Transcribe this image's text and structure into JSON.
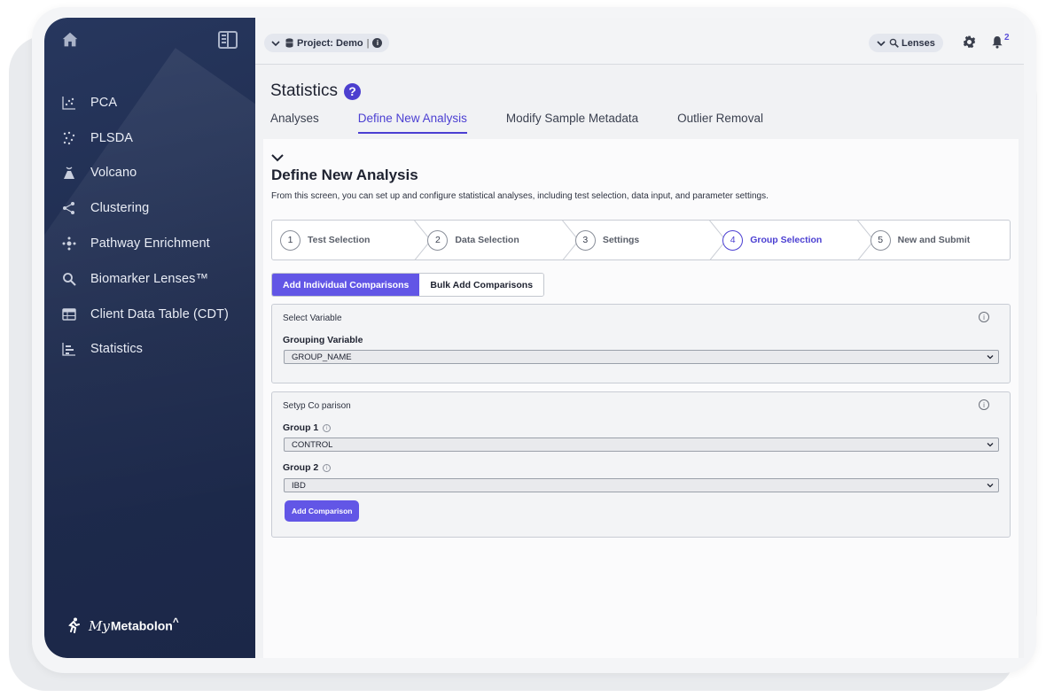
{
  "sidebar": {
    "items": [
      {
        "label": "PCA",
        "icon": "scatter-icon"
      },
      {
        "label": "PLSDA",
        "icon": "scatter-dots-icon"
      },
      {
        "label": "Volcano",
        "icon": "volcano-icon"
      },
      {
        "label": "Clustering",
        "icon": "cluster-icon"
      },
      {
        "label": "Pathway Enrichment",
        "icon": "pathway-icon"
      },
      {
        "label": "Biomarker Lenses™",
        "icon": "lens-search-icon"
      },
      {
        "label": "Client Data Table (CDT)",
        "icon": "table-icon"
      },
      {
        "label": "Statistics",
        "icon": "bar-chart-icon"
      }
    ],
    "brand": {
      "prefix": "My",
      "name": "Metabolon",
      "mark": "^"
    }
  },
  "topbar": {
    "project_label": "Project: Demo",
    "project_sep": "|",
    "lenses_label": "Lenses",
    "notification_count": "2"
  },
  "page": {
    "title": "Statistics",
    "help": "?",
    "tabs": [
      "Analyses",
      "Define New Analysis",
      "Modify Sample Metadata",
      "Outlier Removal"
    ],
    "active_tab": 1
  },
  "section": {
    "title": "Define New Analysis",
    "description": "From this screen, you can set up and configure statistical analyses, including test selection, data input, and parameter settings."
  },
  "steps": [
    {
      "num": "1",
      "label": "Test Selection"
    },
    {
      "num": "2",
      "label": "Data Selection"
    },
    {
      "num": "3",
      "label": "Settings"
    },
    {
      "num": "4",
      "label": "Group Selection"
    },
    {
      "num": "5",
      "label": "New and Submit"
    }
  ],
  "active_step": 4,
  "toggle": {
    "individual": "Add Individual Comparisons",
    "bulk": "Bulk Add Comparisons"
  },
  "select_variable": {
    "header": "Select Variable",
    "grouping_label": "Grouping Variable",
    "grouping_value": "GROUP_NAME"
  },
  "comparison": {
    "header": "Setyp Co parison",
    "group1_label": "Group 1",
    "group1_value": "CONTROL",
    "group2_label": "Group 2",
    "group2_value": "IBD",
    "add_button": "Add Comparison"
  },
  "colors": {
    "sidebar": "#1e2b4d",
    "accent": "#4b3fd2",
    "button": "#6256e6"
  }
}
